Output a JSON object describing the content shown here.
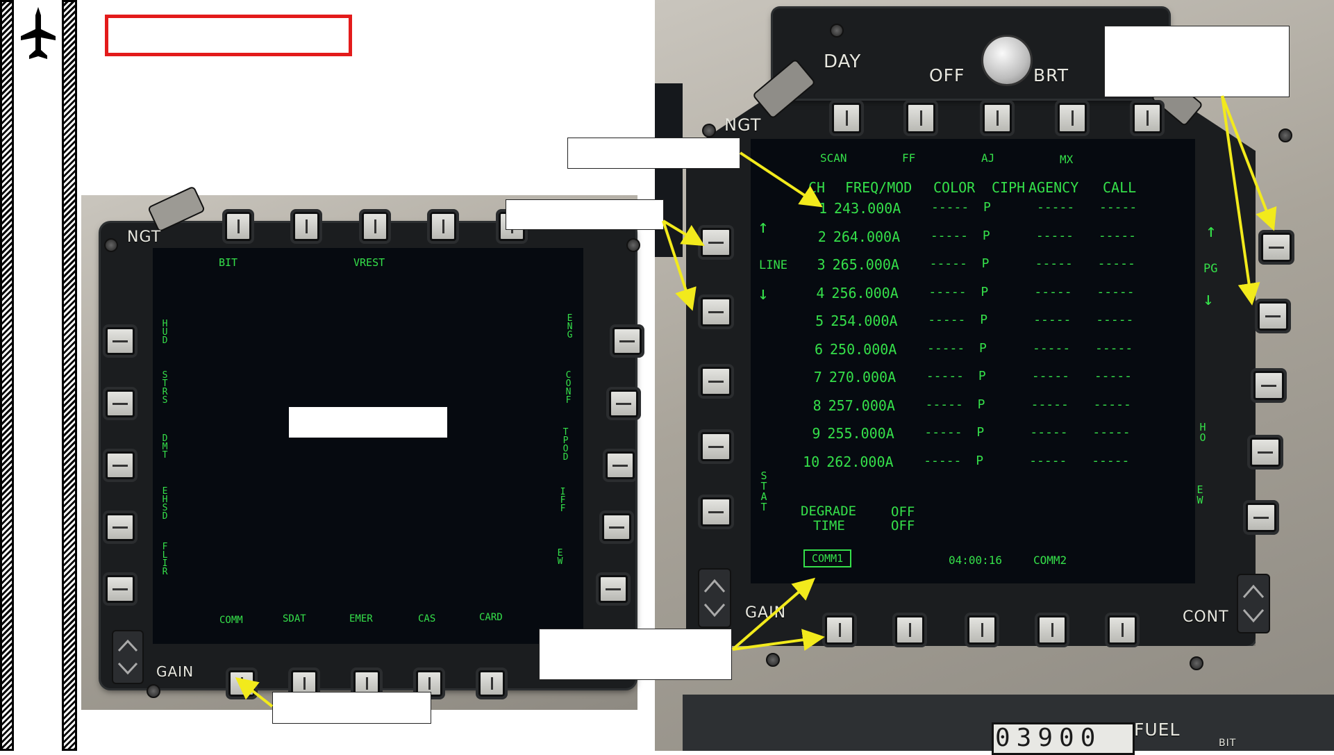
{
  "sidebar": {
    "logo_icon": "aircraft-icon"
  },
  "left_mfd": {
    "panel_labels": {
      "ngt": "NGT",
      "gain": "GAIN"
    },
    "top_labels": [
      "BIT",
      "VREST"
    ],
    "left_labels": [
      "HUD",
      "STRS",
      "DMT",
      "EHSD",
      "FLIR"
    ],
    "right_labels": [
      "ENG",
      "CONF",
      "TPOD",
      "IFF",
      "EW"
    ],
    "bottom_labels": [
      "COMM",
      "SDAT",
      "EMER",
      "CAS",
      "CARD"
    ]
  },
  "right_mfd": {
    "panel_labels": {
      "day": "DAY",
      "off": "OFF",
      "brt": "BRT",
      "ngt": "NGT",
      "gain": "GAIN",
      "cont": "CONT"
    },
    "top_labels": [
      "SCAN",
      "FF",
      "AJ",
      "MX"
    ],
    "headers": [
      "CH",
      "FREQ/MOD",
      "COLOR",
      "CIPH",
      "AGENCY",
      "CALL"
    ],
    "rows": [
      {
        "ch": "1",
        "freq": "243.000A",
        "color": "-----",
        "ciph": "P",
        "agency": "-----",
        "call": "-----"
      },
      {
        "ch": "2",
        "freq": "264.000A",
        "color": "-----",
        "ciph": "P",
        "agency": "-----",
        "call": "-----"
      },
      {
        "ch": "3",
        "freq": "265.000A",
        "color": "-----",
        "ciph": "P",
        "agency": "-----",
        "call": "-----"
      },
      {
        "ch": "4",
        "freq": "256.000A",
        "color": "-----",
        "ciph": "P",
        "agency": "-----",
        "call": "-----"
      },
      {
        "ch": "5",
        "freq": "254.000A",
        "color": "-----",
        "ciph": "P",
        "agency": "-----",
        "call": "-----"
      },
      {
        "ch": "6",
        "freq": "250.000A",
        "color": "-----",
        "ciph": "P",
        "agency": "-----",
        "call": "-----"
      },
      {
        "ch": "7",
        "freq": "270.000A",
        "color": "-----",
        "ciph": "P",
        "agency": "-----",
        "call": "-----"
      },
      {
        "ch": "8",
        "freq": "257.000A",
        "color": "-----",
        "ciph": "P",
        "agency": "-----",
        "call": "-----"
      },
      {
        "ch": "9",
        "freq": "255.000A",
        "color": "-----",
        "ciph": "P",
        "agency": "-----",
        "call": "-----"
      },
      {
        "ch": "10",
        "freq": "262.000A",
        "color": "-----",
        "ciph": "P",
        "agency": "-----",
        "call": "-----"
      }
    ],
    "left_side": {
      "line": "LINE",
      "stat": "STAT",
      "up_arrow": "↑",
      "down_arrow": "↓"
    },
    "right_side": {
      "pg": "PG",
      "ho": "HO",
      "ew": "EW",
      "up_arrow": "↑",
      "down_arrow": "↓"
    },
    "degrade": {
      "label1": "DEGRADE",
      "label2": "TIME",
      "value1": "OFF",
      "value2": "OFF"
    },
    "bottom": {
      "comm1": "COMM1",
      "time": "04:00:16",
      "comm2": "COMM2"
    },
    "fuel": {
      "label": "FUEL",
      "value": "03900",
      "bit": "BIT"
    }
  },
  "colors": {
    "mfd_text": "#35e04a",
    "callout_border": "#e31b1b",
    "arrow": "#f2ea1c"
  }
}
